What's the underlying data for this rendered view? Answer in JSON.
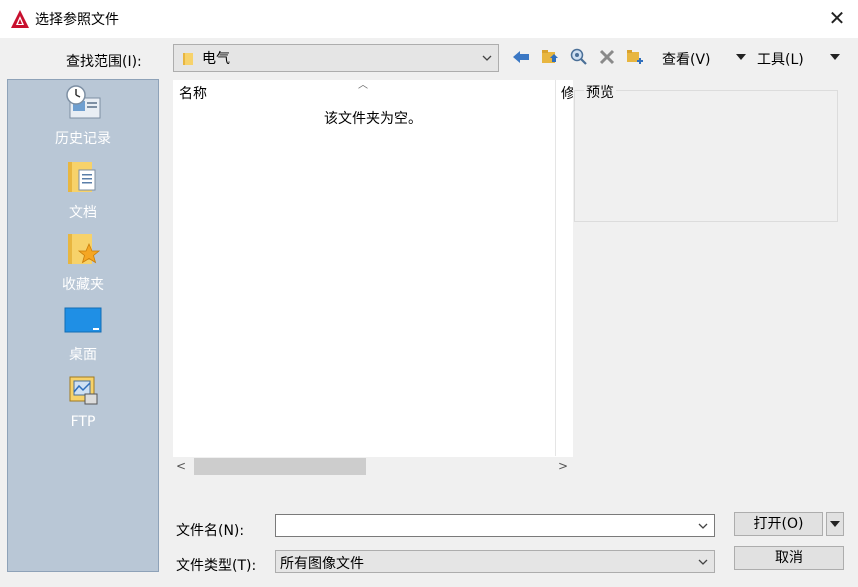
{
  "window": {
    "title": "选择参照文件",
    "close_symbol": "✕",
    "app_icon": "autocad-icon"
  },
  "toolbar": {
    "look_in_label": "查找范围(I):",
    "look_in_value": "电气",
    "back_icon": "back-arrow-icon",
    "up_icon": "folder-up-icon",
    "search_icon": "search-web-icon",
    "delete_icon": "delete-icon",
    "new_folder_icon": "new-folder-icon",
    "views_label": "查看(V)",
    "tools_label": "工具(L)"
  },
  "places": [
    {
      "label": "历史记录",
      "icon": "history-icon"
    },
    {
      "label": "文档",
      "icon": "documents-icon"
    },
    {
      "label": "收藏夹",
      "icon": "favorites-icon"
    },
    {
      "label": "桌面",
      "icon": "desktop-icon"
    },
    {
      "label": "FTP",
      "icon": "ftp-icon"
    }
  ],
  "file_list": {
    "column_name": "名称",
    "column_modified": "修",
    "empty_message": "该文件夹为空。"
  },
  "preview": {
    "label": "预览"
  },
  "bottom": {
    "filename_label": "文件名(N):",
    "filename_value": "",
    "filetype_label": "文件类型(T):",
    "filetype_value": "所有图像文件",
    "open_label": "打开(O)",
    "cancel_label": "取消"
  },
  "colors": {
    "places_bg": "#b9c7d6",
    "accent_blue": "#2f6fbd",
    "autocad_red": "#c8102e"
  }
}
